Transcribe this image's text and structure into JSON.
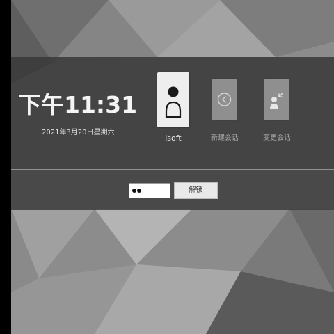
{
  "clock": {
    "time": "下午11:31",
    "date": "2021年3月20日星期六"
  },
  "user": {
    "name": "isoft",
    "icon": "user-avatar-icon"
  },
  "actions": [
    {
      "label": "新建会话",
      "icon": "back-chevron-icon"
    },
    {
      "label": "变更会话",
      "icon": "switch-user-icon"
    }
  ],
  "password": {
    "value": "••",
    "masked_length": 2
  },
  "unlock": {
    "label": "解锁"
  },
  "colors": {
    "panel": "#3a3a3a",
    "card_active": "#eeeeee",
    "card_inactive": "#8f8f8f"
  }
}
